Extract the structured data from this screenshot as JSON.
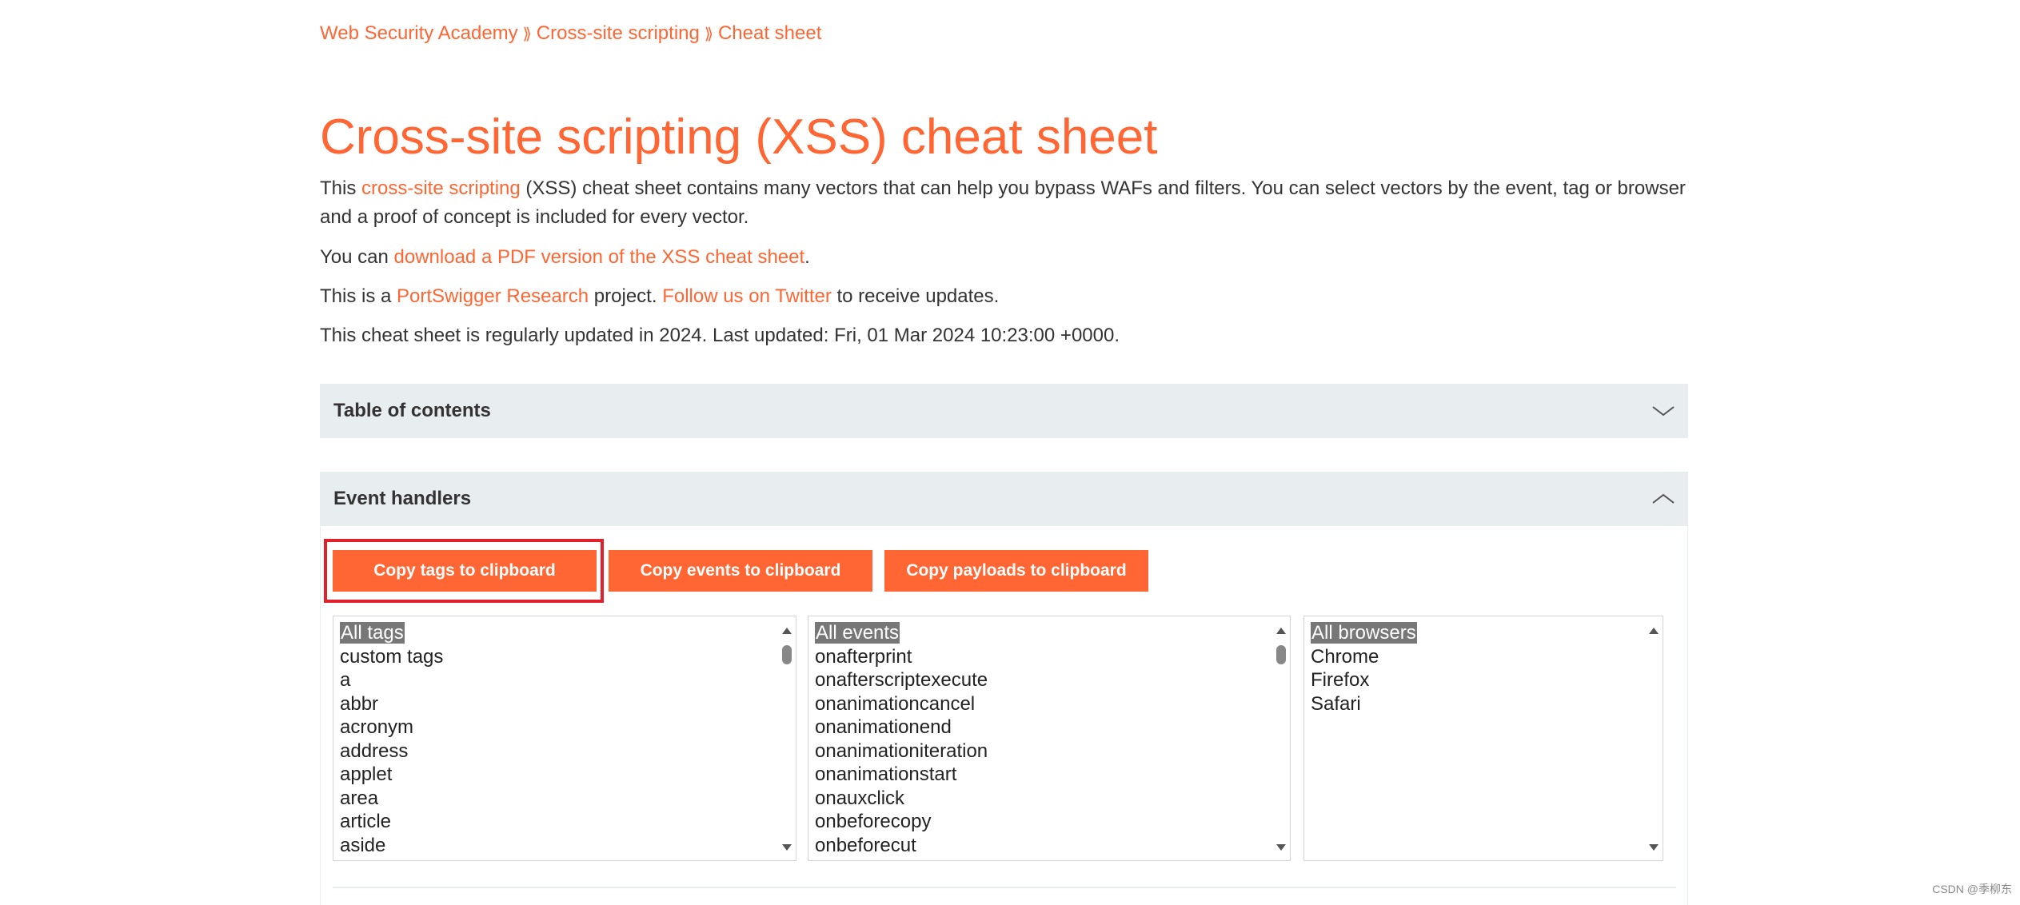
{
  "breadcrumb": {
    "items": [
      "Web Security Academy",
      "Cross-site scripting",
      "Cheat sheet"
    ],
    "separator": "⟫"
  },
  "page_title": "Cross-site scripting (XSS) cheat sheet",
  "intro": {
    "p1_before": "This ",
    "p1_link": "cross-site scripting",
    "p1_after": " (XSS) cheat sheet contains many vectors that can help you bypass WAFs and filters. You can select vectors by the event, tag or browser and a proof of concept is included for every vector.",
    "p2_before": "You can ",
    "p2_link": "download a PDF version of the XSS cheat sheet",
    "p2_after": ".",
    "p3_before": "This is a ",
    "p3_link1": "PortSwigger Research",
    "p3_middle": " project. ",
    "p3_link2": "Follow us on Twitter",
    "p3_after": " to receive updates.",
    "p4": "This cheat sheet is regularly updated in 2024. Last updated: Fri, 01 Mar 2024 10:23:00 +0000."
  },
  "toc": {
    "title": "Table of contents",
    "icon": "chevron-down-icon"
  },
  "event_handlers": {
    "title": "Event handlers",
    "icon": "chevron-up-icon",
    "buttons": {
      "copy_tags": "Copy tags to clipboard",
      "copy_events": "Copy events to clipboard",
      "copy_payloads": "Copy payloads to clipboard"
    },
    "tags": [
      "All tags",
      "custom tags",
      "a",
      "abbr",
      "acronym",
      "address",
      "applet",
      "area",
      "article",
      "aside"
    ],
    "events": [
      "All events",
      "onafterprint",
      "onafterscriptexecute",
      "onanimationcancel",
      "onanimationend",
      "onanimationiteration",
      "onanimationstart",
      "onauxclick",
      "onbeforecopy",
      "onbeforecut"
    ],
    "browsers": [
      "All browsers",
      "Chrome",
      "Firefox",
      "Safari"
    ]
  },
  "colors": {
    "accent": "#ff6633",
    "accordion_bg": "#e8edf0",
    "highlight": "#e0202a"
  },
  "watermark": "CSDN @季柳东"
}
